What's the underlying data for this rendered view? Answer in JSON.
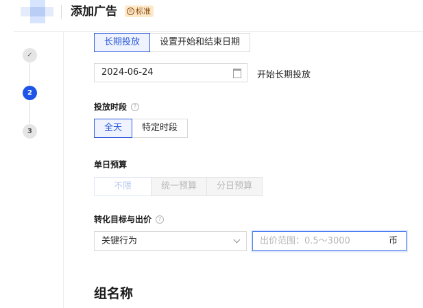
{
  "header": {
    "title": "添加广告",
    "badge_icon": "⊙",
    "badge_label": "标准"
  },
  "steps": [
    {
      "label": "✓",
      "state": "done"
    },
    {
      "label": "2",
      "state": "active"
    },
    {
      "label": "3",
      "state": "todo"
    }
  ],
  "schedule": {
    "mode_tabs": [
      "长期投放",
      "设置开始和结束日期"
    ],
    "selected_mode": "长期投放",
    "start_date": "2024-06-24",
    "start_note": "开始长期投放"
  },
  "time_slot": {
    "label": "投放时段",
    "options": [
      "全天",
      "特定时段"
    ],
    "selected": "全天"
  },
  "daily_budget": {
    "label": "单日预算",
    "options": [
      "不限",
      "统一预算",
      "分日预算"
    ],
    "selected": "不限"
  },
  "conversion": {
    "label": "转化目标与出价",
    "goal_value": "关键行为",
    "bid_placeholder": "出价范围：0.5～3000",
    "bid_unit": "币"
  },
  "group": {
    "title": "组名称"
  },
  "colors": {
    "primary": "#2d5bd8",
    "step_active": "#1f55e6",
    "badge_bg": "#fde8c8"
  }
}
